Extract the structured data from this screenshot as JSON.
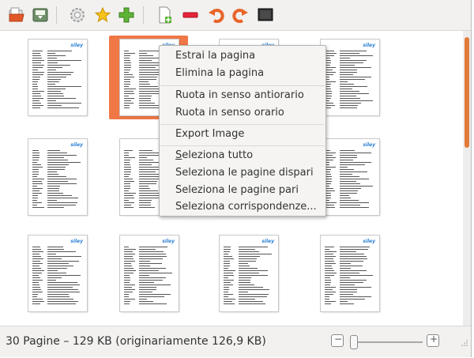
{
  "toolbar": {
    "buttons": [
      {
        "name": "open-file-button",
        "icon": "folder-open-icon"
      },
      {
        "name": "save-button",
        "icon": "save-icon"
      },
      {
        "name": "settings-button",
        "icon": "gear-icon"
      },
      {
        "name": "favorite-button",
        "icon": "star-icon"
      },
      {
        "name": "add-button",
        "icon": "plus-icon"
      },
      {
        "name": "insert-page-button",
        "icon": "new-page-icon"
      },
      {
        "name": "delete-button",
        "icon": "minus-icon"
      },
      {
        "name": "rotate-left-button",
        "icon": "rotate-left-icon"
      },
      {
        "name": "rotate-right-button",
        "icon": "rotate-right-icon"
      },
      {
        "name": "fullscreen-button",
        "icon": "screen-icon"
      }
    ]
  },
  "pages": {
    "logo_text": "siley",
    "count_visible": 12,
    "selected_index": 1
  },
  "context_menu": {
    "items": [
      {
        "label": "Estrai la pagina"
      },
      {
        "label": "Elimina la pagina"
      },
      {
        "label": "Ruota in senso antiorario"
      },
      {
        "label": "Ruota in senso orario"
      },
      {
        "label": "Export Image"
      },
      {
        "label_underlined": "S",
        "label_rest": "eleziona tutto"
      },
      {
        "label": "Seleziona le pagine dispari"
      },
      {
        "label": "Seleziona le pagine pari"
      },
      {
        "label": "Seleziona corrispondenze..."
      }
    ]
  },
  "status": {
    "text": "30 Pagine – 129 KB (originariamente 126,9 KB)",
    "zoom_out_symbol": "−",
    "zoom_in_symbol": "+",
    "zoom_level_fraction": 0.05
  },
  "colors": {
    "accent": "#f07746",
    "logo": "#2a7fd4"
  }
}
